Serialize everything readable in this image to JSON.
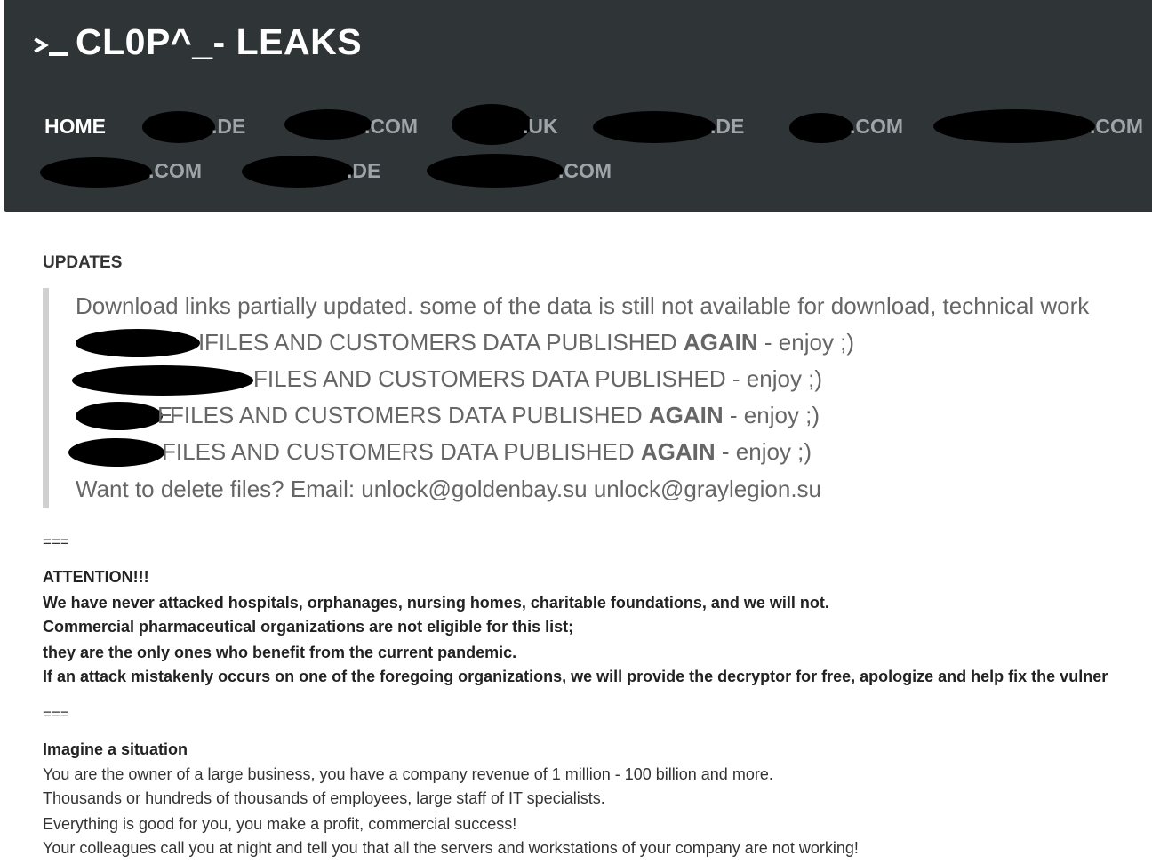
{
  "header": {
    "brand_title": "CL0P^_- LEAKS",
    "brand_icon": "terminal-prompt-icon",
    "background_color": "#2f3437",
    "nav": [
      {
        "label": "HOME",
        "active": true
      },
      {
        "label": ".DE",
        "redacted": true
      },
      {
        "label": ".COM",
        "redacted": true
      },
      {
        "label": ".UK",
        "redacted": true
      },
      {
        "label": ".DE",
        "redacted": true
      },
      {
        "label": ".COM",
        "redacted": true
      },
      {
        "label": ".COM",
        "redacted": true
      },
      {
        "label": ".COM",
        "redacted": true
      },
      {
        "label": ".DE",
        "redacted": true
      },
      {
        "label": ".COM",
        "redacted": true
      }
    ]
  },
  "updates": {
    "heading": "UPDATES",
    "lines": [
      {
        "text": "Download links partially updated. some of the data is still not available for download, technical work"
      },
      {
        "prefix": "I",
        "text": " FILES AND CUSTOMERS DATA PUBLISHED ",
        "bold": "AGAIN",
        "suffix": " - enjoy ;)",
        "redacted": true
      },
      {
        "prefix": "",
        "text": " FILES AND CUSTOMERS DATA PUBLISHED",
        "bold": "",
        "suffix": " - enjoy ;)",
        "redacted": true
      },
      {
        "prefix": "E",
        "text": " FILES AND CUSTOMERS DATA PUBLISHED ",
        "bold": "AGAIN",
        "suffix": " - enjoy ;)",
        "redacted": true
      },
      {
        "prefix": "",
        "text": " FILES AND CUSTOMERS DATA PUBLISHED ",
        "bold": "AGAIN",
        "suffix": " - enjoy ;)",
        "redacted": true
      },
      {
        "text": "Want to delete files? Email: unlock@goldenbay.su unlock@graylegion.su"
      }
    ]
  },
  "separator": "===",
  "attention": {
    "title": "ATTENTION!!!",
    "lines": [
      "We have never attacked hospitals, orphanages, nursing homes, charitable foundations, and we will not.",
      "Commercial pharmaceutical organizations are not eligible for this list;",
      "they are the only ones who benefit from the current pandemic.",
      "If an attack mistakenly occurs on one of the foregoing organizations, we will provide the decryptor for free, apologize and help fix the vulner"
    ]
  },
  "situation": {
    "title": "Imagine a situation",
    "lines": [
      "You are the owner of a large business, you have a company revenue of 1 million - 100 billion and more.",
      "Thousands or hundreds of thousands of employees, large staff of IT specialists.",
      "Everything is good for you, you make a profit, commercial success!",
      "Your colleagues call you at night and tell you that all the servers and workstations of your company are not working!"
    ]
  }
}
